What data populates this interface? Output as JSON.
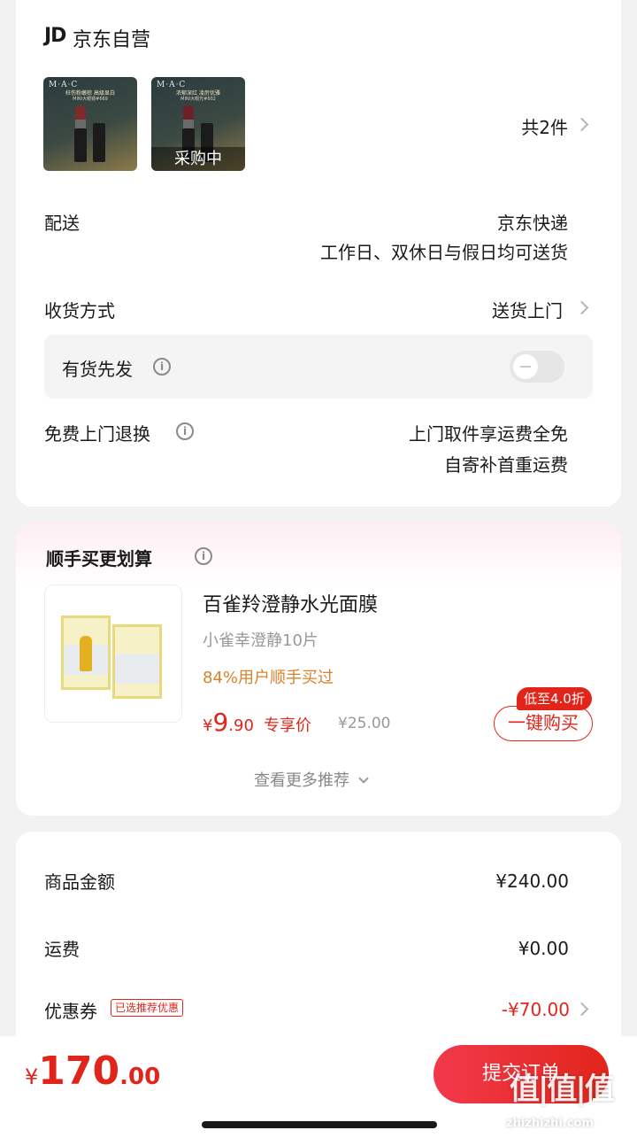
{
  "store": {
    "logo": "JD",
    "name": "京东自营"
  },
  "products": {
    "items": [
      {
        "brand": "M·A·C",
        "line1": "枉伤粉嫩棕 高级显白",
        "line2": "MINI大眼镜#669",
        "lip_color": "#7c2a2a",
        "caption": ""
      },
      {
        "brand": "M·A·C",
        "line1": "浓郁深红 凌厉优雅",
        "line2": "MINI大眼光#602",
        "lip_color": "#6e2026",
        "caption": "采购中"
      }
    ],
    "count_label": "共2件"
  },
  "delivery": {
    "label": "配送",
    "carrier": "京东快递",
    "schedule": "工作日、双休日与假日均可送货"
  },
  "receive": {
    "label": "收货方式",
    "value": "送货上门"
  },
  "ship_first": {
    "label": "有货先发",
    "enabled": false
  },
  "free_return": {
    "label": "免费上门退换",
    "line1": "上门取件享运费全免",
    "line2": "自寄补首重运费"
  },
  "upsell": {
    "title": "顺手买更划算",
    "product_name": "百雀羚澄静水光面膜",
    "spec": "小雀幸澄静10片",
    "social": "84%用户顺手买过",
    "currency": "¥",
    "price_int": "9",
    "price_dec": ".90",
    "price_tag": "专享价",
    "original_price": "¥25.00",
    "discount_badge": "低至4.0折",
    "buy_label": "一键购买",
    "more_label": "查看更多推荐"
  },
  "summary": {
    "goods_label": "商品金额",
    "goods_value": "¥240.00",
    "freight_label": "运费",
    "freight_value": "¥0.00",
    "coupon_label": "优惠券",
    "coupon_tag": "已选推荐优惠",
    "coupon_value": "-¥70.00"
  },
  "footer": {
    "currency": "¥",
    "total_int": "170",
    "total_dec": ".00",
    "submit_label": "提交订单"
  },
  "watermark": {
    "text": "值|值|值",
    "url": "zhizhizhi.com"
  },
  "colors": {
    "accent_red": "#e1251b",
    "orange": "#d9822b",
    "background": "#f2f2f2"
  }
}
